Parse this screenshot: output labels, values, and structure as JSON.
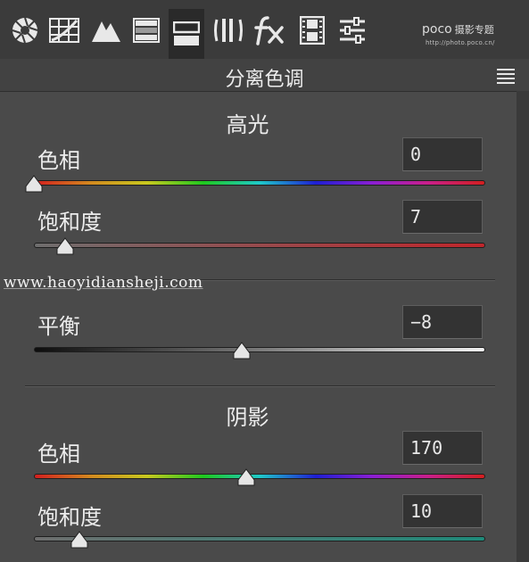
{
  "toolbar": {
    "icons": [
      "aperture-icon",
      "histogram-grid-icon",
      "tone-curve-icon",
      "hsl-panel-icon",
      "split-toning-icon",
      "lens-correction-icon",
      "fx-icon",
      "filmstrip-icon",
      "sliders-icon"
    ],
    "active_icon": "split-toning-icon"
  },
  "brand": {
    "logo": "poco",
    "name": "摄影专题",
    "url": "http://photo.poco.cn/"
  },
  "panel": {
    "title": "分离色调"
  },
  "highlights": {
    "heading": "高光",
    "hue": {
      "label": "色相",
      "value": "0",
      "position": 0.0
    },
    "saturation": {
      "label": "饱和度",
      "value": "7",
      "position": 0.07
    }
  },
  "balance": {
    "label": "平衡",
    "value": "−8",
    "position": 0.46
  },
  "shadows": {
    "heading": "阴影",
    "hue": {
      "label": "色相",
      "value": "170",
      "position": 0.47
    },
    "saturation": {
      "label": "饱和度",
      "value": "10",
      "position": 0.1
    }
  },
  "watermark": "www.haoyidiansheji.com",
  "colors": {
    "toolbar_bg": "#3b3b3b",
    "panel_bg": "#4a4a4a",
    "highlight_sat_tint": "#c0262b",
    "shadow_sat_tint": "#1f8a7a"
  }
}
